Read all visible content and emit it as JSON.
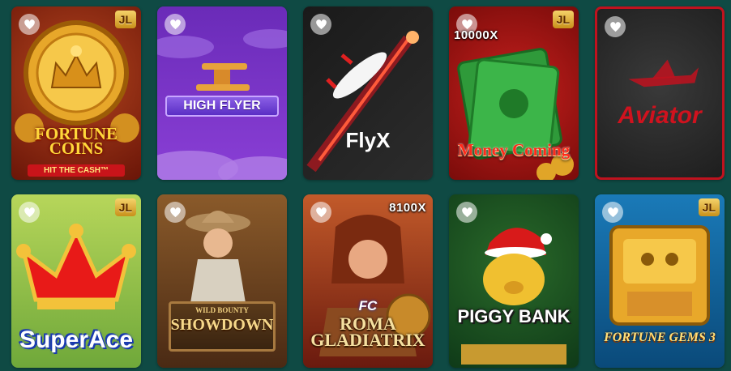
{
  "games": [
    {
      "id": "fortune-coins",
      "title_line1": "FORTUNE",
      "title_line2": "COINS",
      "subtitle": "HIT THE CASH™",
      "provider": "JL"
    },
    {
      "id": "high-flyer",
      "title": "HIGH FLYER"
    },
    {
      "id": "flyx",
      "title": "FlyX",
      "title_accent": "X"
    },
    {
      "id": "money-coming",
      "title": "Money Coming",
      "provider": "JL",
      "multiplier": "10000X"
    },
    {
      "id": "aviator",
      "title": "Aviator"
    },
    {
      "id": "super-ace",
      "title": "SuperAce",
      "provider": "JL"
    },
    {
      "id": "showdown",
      "title_small": "WILD BOUNTY",
      "title": "SHOWDOWN"
    },
    {
      "id": "roma-gladiatrix",
      "badge": "FC",
      "title_line1": "ROMA",
      "title_line2": "GLADIATRIX",
      "multiplier": "8100X"
    },
    {
      "id": "piggy-bank",
      "title": "PIGGY BANK"
    },
    {
      "id": "fortune-gems-3",
      "title": "FORTUNE GEMS 3",
      "provider": "JL"
    }
  ],
  "icons": {
    "favorite": "heart-icon"
  },
  "colors": {
    "background": "#0f4a44",
    "provider_badge": "#d9a52a"
  }
}
